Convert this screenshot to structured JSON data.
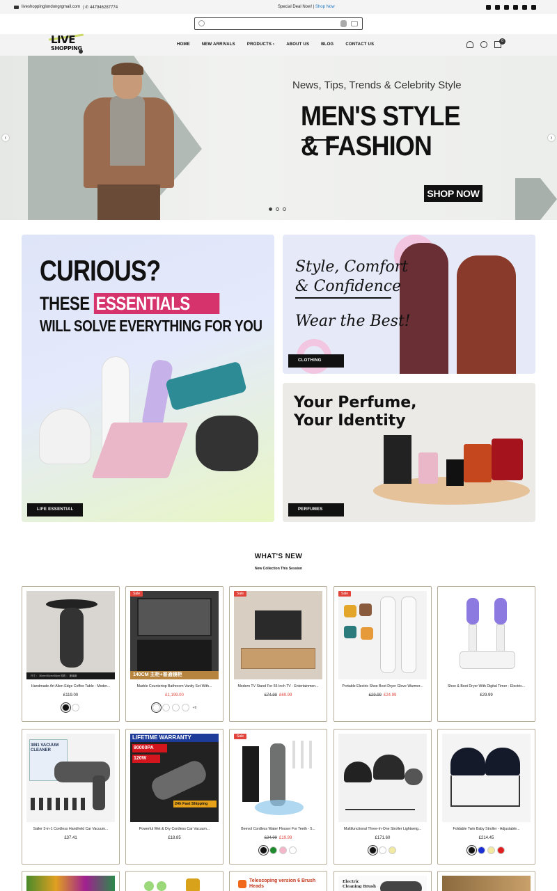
{
  "topbar": {
    "email": "liveshoppinglondongrgmail.com",
    "phone": "| ✆ 447946287774",
    "deal_text": "Special Deal Now! |",
    "deal_link": "Shop Now",
    "social": [
      "facebook-icon",
      "instagram-icon",
      "twitter-icon",
      "pinterest-icon",
      "youtube-icon",
      "tiktok-icon"
    ]
  },
  "logo": {
    "line1": "LIVE",
    "line2": "SHOPPING"
  },
  "nav": {
    "items": [
      "HOME",
      "NEW ARRIVALS",
      "PRODUCTS ›",
      "ABOUT US",
      "BLOG",
      "CONTACT US"
    ],
    "cart_count": "0"
  },
  "hero": {
    "tagline": "News, Tips, Trends & Celebrity Style",
    "title": "MEN'S STYLE & FASHION",
    "cta": "SHOP NOW",
    "prev": "‹",
    "next": "›",
    "slides": 3,
    "active_slide": 1
  },
  "banners": {
    "left": {
      "line1": "CURIOUS?",
      "line2a": "THESE ",
      "line2b": "ESSENTIALS",
      "line3": "WILL SOLVE EVERYTHING FOR YOU",
      "label": "LIFE ESSENTIAL"
    },
    "top_right": {
      "line1": "Style, Comfort",
      "line2": "& Confidence",
      "line3": "Wear the Best!",
      "label": "CLOTHING"
    },
    "bottom_right": {
      "line1": "Your Perfume,",
      "line2": "Your Identity",
      "label": "PERFUMES"
    }
  },
  "section": {
    "title": "WHAT'S NEW",
    "subtitle": "New Collection This Session"
  },
  "products": [
    {
      "name": "Handmade Art Alien Edge Coffee Table - Moder...",
      "price": "£119.00",
      "old": "",
      "sale": false,
      "swatches": [
        "#111111",
        "#ffffff"
      ],
      "more": ""
    },
    {
      "name": "Marble Countertop Bathroom Vanity Set With...",
      "price": "£1,199.00",
      "old": "",
      "sale": true,
      "price_red": true,
      "swatches": [
        "#ffffff",
        "#ffffff",
        "#ffffff",
        "#ffffff"
      ],
      "more": "+9"
    },
    {
      "name": "Modern TV Stand For 55 Inch TV - Entertainmen...",
      "price": "£69.99",
      "old": "£74.99",
      "sale": true,
      "swatches": [],
      "more": ""
    },
    {
      "name": "Portable Electric Shoe Boot Dryer Glove Warmer...",
      "price": "£24.99",
      "old": "£29.99",
      "sale": true,
      "swatches": [],
      "more": ""
    },
    {
      "name": "Shoe & Boot Dryer With Digital Timer - Electric...",
      "price": "£29.99",
      "old": "",
      "sale": false,
      "swatches": [],
      "more": ""
    },
    {
      "name": "Sailer 3-in-1 Cordless Handheld Car Vacuum...",
      "price": "£37.41",
      "old": "",
      "sale": false,
      "swatches": [],
      "more": ""
    },
    {
      "name": "Powerful Wet & Dry Cordless Car Vacuum...",
      "price": "£18.85",
      "old": "",
      "sale": false,
      "swatches": [],
      "more": ""
    },
    {
      "name": "Beevol Cordless Water Flosser For Teeth - 5...",
      "price": "£19.99",
      "old": "£24.99",
      "sale": true,
      "swatches": [
        "#111111",
        "#1e8a2e",
        "#f4b6c8",
        "#ffffff"
      ],
      "more": ""
    },
    {
      "name": "Multifunctional Three-In-One Stroller Lightweig...",
      "price": "£171.60",
      "old": "",
      "sale": false,
      "swatches": [
        "#111111",
        "#ffffff",
        "#f2eaa0"
      ],
      "more": ""
    },
    {
      "name": "Foldable Twin Baby Stroller - Adjustable...",
      "price": "£214.45",
      "old": "",
      "sale": false,
      "swatches": [
        "#111111",
        "#1a2fd6",
        "#f2eaa0",
        "#e02020"
      ],
      "more": ""
    }
  ],
  "product_badges": {
    "sale": "Sale",
    "vanity_caption": "140CM  主柜+普通镜柜",
    "table_caption": "尺寸 ： 50cm×50cm×50cm    材质 ： 玻璃钢",
    "vacuum1_caption": "3IN1 VACUUM CLEANER",
    "vacuum2_warranty": "LIFETIME WARRANTY",
    "vacuum2_pa": "90000PA",
    "vacuum2_w": "120W",
    "vacuum2_ship": "24h Fast Shipping",
    "row3_b3": "Telescoping version 6 Brush Heads",
    "row3_b4": "Electric Cleaning Brush"
  }
}
